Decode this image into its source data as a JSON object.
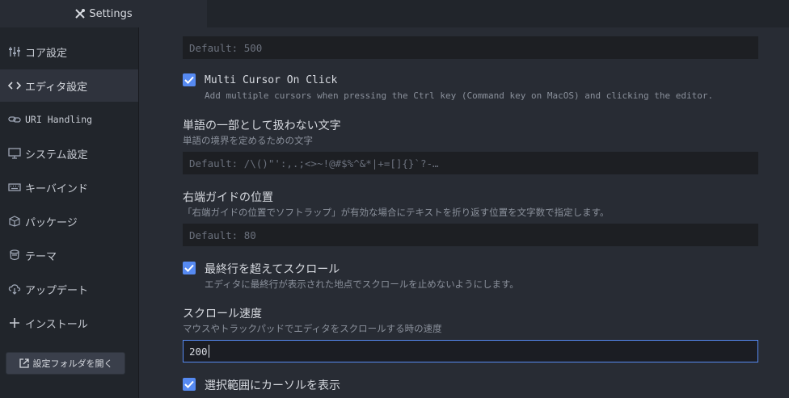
{
  "tab": {
    "title": "Settings",
    "icon": "tools-icon"
  },
  "sidebar": {
    "items": [
      {
        "label": "コア設定",
        "icon": "sliders-icon",
        "active": false
      },
      {
        "label": "エディタ設定",
        "icon": "code-icon",
        "active": true
      },
      {
        "label": "URI Handling",
        "icon": "link-icon",
        "active": false
      },
      {
        "label": "システム設定",
        "icon": "monitor-icon",
        "active": false
      },
      {
        "label": "キーバインド",
        "icon": "keyboard-icon",
        "active": false
      },
      {
        "label": "パッケージ",
        "icon": "package-icon",
        "active": false
      },
      {
        "label": "テーマ",
        "icon": "paintcan-icon",
        "active": false
      },
      {
        "label": "アップデート",
        "icon": "cloud-download-icon",
        "active": false
      },
      {
        "label": "インストール",
        "icon": "plus-icon",
        "active": false
      }
    ],
    "open_folder_button": "設定フォルダを開く"
  },
  "settings": {
    "top_field": {
      "placeholder": "Default: 500"
    },
    "multi_cursor": {
      "title": "Multi Cursor On Click",
      "description": "Add multiple cursors when pressing the Ctrl key (Command key on MacOS) and clicking the editor.",
      "checked": true
    },
    "non_word_chars": {
      "title": "単語の一部として扱わない文字",
      "description": "単語の境界を定めるための文字",
      "placeholder": "Default: /\\()\"':,.;<>~!@#$%^&*|+=[]{}`?-…"
    },
    "preferred_line_length": {
      "title": "右端ガイドの位置",
      "description": "「右端ガイドの位置でソフトラップ」が有効な場合にテキストを折り返す位置を文字数で指定します。",
      "placeholder": "Default: 80"
    },
    "scroll_past_end": {
      "title": "最終行を超えてスクロール",
      "description": "エディタに最終行が表示された地点でスクロールを止めないようにします。",
      "checked": true
    },
    "scroll_sensitivity": {
      "title": "スクロール速度",
      "description": "マウスやトラックパッドでエディタをスクロールする時の速度",
      "value": "200"
    },
    "show_cursor_on_selection": {
      "title": "選択範囲にカーソルを表示",
      "checked": true
    }
  }
}
